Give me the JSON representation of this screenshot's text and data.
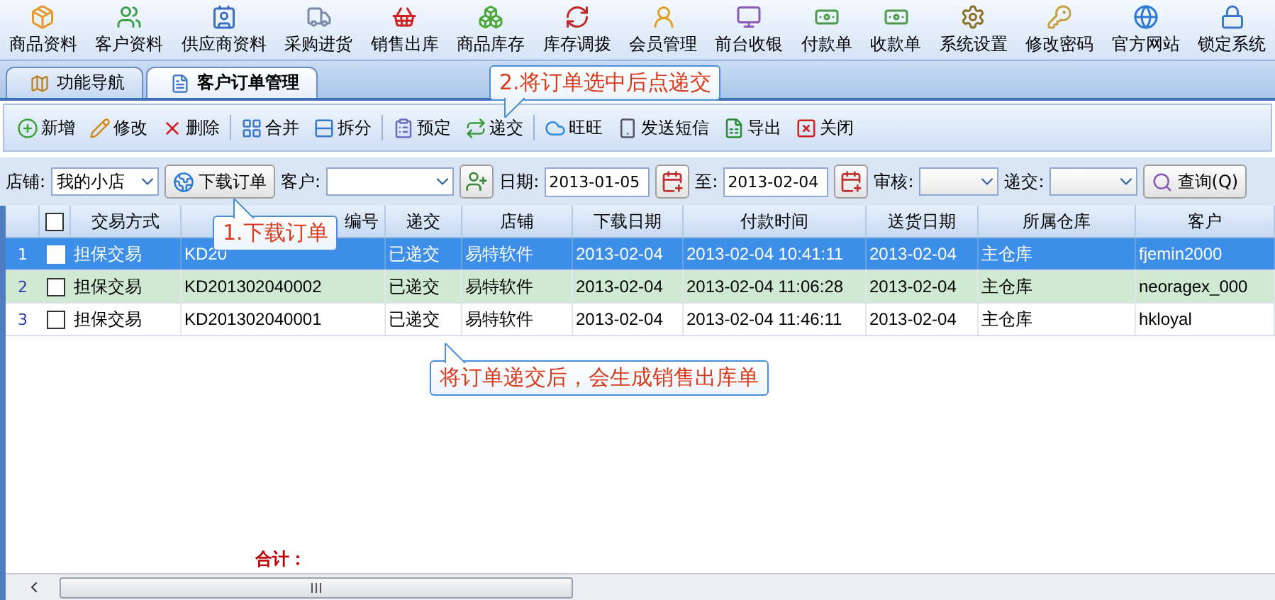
{
  "menu": [
    {
      "label": "商品资料"
    },
    {
      "label": "客户资料"
    },
    {
      "label": "供应商资料"
    },
    {
      "label": "采购进货"
    },
    {
      "label": "销售出库"
    },
    {
      "label": "商品库存"
    },
    {
      "label": "库存调拨"
    },
    {
      "label": "会员管理"
    },
    {
      "label": "前台收银"
    },
    {
      "label": "付款单"
    },
    {
      "label": "收款单"
    },
    {
      "label": "系统设置"
    },
    {
      "label": "修改密码"
    },
    {
      "label": "官方网站"
    },
    {
      "label": "锁定系统"
    }
  ],
  "tabs": [
    {
      "label": "功能导航",
      "selected": false
    },
    {
      "label": "客户订单管理",
      "selected": true
    }
  ],
  "toolbar": [
    {
      "label": "新增"
    },
    {
      "label": "修改"
    },
    {
      "label": "删除"
    },
    {
      "label": "合并"
    },
    {
      "label": "拆分"
    },
    {
      "label": "预定"
    },
    {
      "label": "递交"
    },
    {
      "label": "旺旺"
    },
    {
      "label": "发送短信"
    },
    {
      "label": "导出"
    },
    {
      "label": "关闭"
    }
  ],
  "filters": {
    "shop_label": "店铺:",
    "shop_value": "我的小店",
    "download_button": "下载订单",
    "customer_label": "客户:",
    "date_label": "日期:",
    "date_from": "2013-01-05",
    "to_label": "至:",
    "date_to": "2013-02-04",
    "audit_label": "审核:",
    "submit_label": "递交:",
    "query_button": "查询(Q)"
  },
  "table": {
    "header_checked": false,
    "columns": [
      {
        "label": "交易方式"
      },
      {
        "label": "编号"
      },
      {
        "label": "递交"
      },
      {
        "label": "店铺"
      },
      {
        "label": "下载日期"
      },
      {
        "label": "付款时间"
      },
      {
        "label": "送货日期"
      },
      {
        "label": "所属仓库"
      },
      {
        "label": "客户"
      }
    ],
    "rows": [
      {
        "num": "1",
        "checked": false,
        "selected": true,
        "highlighted": false,
        "cells": [
          "担保交易",
          "KD20",
          "已递交",
          "易特软件",
          "2013-02-04",
          "2013-02-04 10:41:11",
          "2013-02-04",
          "主仓库",
          "fjemin2000"
        ]
      },
      {
        "num": "2",
        "checked": false,
        "selected": false,
        "highlighted": true,
        "cells": [
          "担保交易",
          "KD201302040002",
          "已递交",
          "易特软件",
          "2013-02-04",
          "2013-02-04 11:06:28",
          "2013-02-04",
          "主仓库",
          "neoragex_000"
        ]
      },
      {
        "num": "3",
        "checked": false,
        "selected": false,
        "highlighted": false,
        "cells": [
          "担保交易",
          "KD201302040001",
          "已递交",
          "易特软件",
          "2013-02-04",
          "2013-02-04 11:46:11",
          "2013-02-04",
          "主仓库",
          "hkloyal"
        ]
      }
    ]
  },
  "footer": {
    "total_label": "合计："
  },
  "callouts": [
    {
      "text": "2.将订单选中后点递交"
    },
    {
      "text": "1.下载订单"
    },
    {
      "text": "将订单递交后，会生成销售出库单"
    }
  ]
}
